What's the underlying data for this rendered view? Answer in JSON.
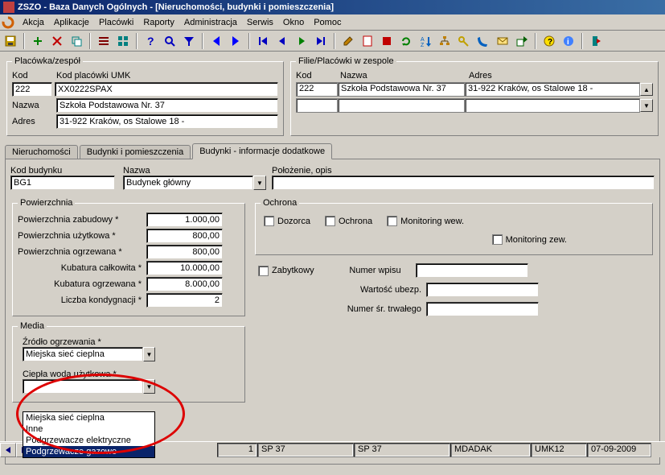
{
  "window": {
    "title": "ZSZO - Baza Danych Ogólnych - [Nieruchomości, budynki i pomieszczenia]"
  },
  "menu": {
    "items": [
      "Akcja",
      "Aplikacje",
      "Placówki",
      "Raporty",
      "Administracja",
      "Serwis",
      "Okno",
      "Pomoc"
    ]
  },
  "groupA": {
    "legend": "Placówka/zespół",
    "kod_lbl": "Kod",
    "kod_val": "222",
    "kodumk_lbl": "Kod placówki UMK",
    "kodumk_val": "XX0222SPAX",
    "nazwa_lbl": "Nazwa",
    "nazwa_val": "Szkoła Podstawowa Nr. 37",
    "adres_lbl": "Adres",
    "adres_val": "31-922 Kraków, os Stalowe 18 -"
  },
  "groupB": {
    "legend": "Filie/Placówki w zespole",
    "hdr_kod": "Kod",
    "hdr_nazwa": "Nazwa",
    "hdr_adres": "Adres",
    "row1_kod": "222",
    "row1_nazwa": "Szkoła Podstawowa Nr. 37",
    "row1_adres": "31-922 Kraków, os Stalowe 18 -"
  },
  "tabs": {
    "t1": "Nieruchomości",
    "t2": "Budynki i pomieszczenia",
    "t3": "Budynki - informacje dodatkowe"
  },
  "bldg": {
    "kod_lbl": "Kod budynku",
    "kod_val": "BG1",
    "nazwa_lbl": "Nazwa",
    "nazwa_val": "Budynek główny",
    "pol_lbl": "Położenie, opis",
    "pol_val": ""
  },
  "pow": {
    "legend": "Powierzchnia",
    "zab_lbl": "Powierzchnia zabudowy *",
    "zab_val": "1.000,00",
    "uzy_lbl": "Powierzchnia użytkowa *",
    "uzy_val": "800,00",
    "ogr_lbl": "Powierzchnia ogrzewana *",
    "ogr_val": "800,00",
    "kubc_lbl": "Kubatura całkowita *",
    "kubc_val": "10.000,00",
    "kubo_lbl": "Kubatura ogrzewana *",
    "kubo_val": "8.000,00",
    "kond_lbl": "Liczba kondygnacji *",
    "kond_val": "2"
  },
  "ochrona": {
    "legend": "Ochrona",
    "dozorca": "Dozorca",
    "ochrona": "Ochrona",
    "mwew": "Monitoring wew.",
    "mzew": "Monitoring zew.",
    "zab": "Zabytkowy",
    "nrwpis_lbl": "Numer wpisu",
    "nrwpis_val": "",
    "wart_lbl": "Wartość ubezp.",
    "wart_val": "",
    "nrtrw_lbl": "Numer śr. trwałego",
    "nrtrw_val": ""
  },
  "media": {
    "legend": "Media",
    "zrodlo_lbl": "Źródło ogrzewania *",
    "zrodlo_val": "Miejska sieć cieplna",
    "ciepla_lbl": "Ciepła woda użytkowa *",
    "ciepla_val": "",
    "opt1": "Miejska sieć cieplna",
    "opt2": "Inne",
    "opt3": "Podgrzewacze elektryczne",
    "opt4": "Podgrzewacze gazowe"
  },
  "status": {
    "n": "1",
    "sp1": "SP 37",
    "sp2": "SP 37",
    "user": "MDADAK",
    "code": "UMK12",
    "date": "07-09-2009"
  }
}
